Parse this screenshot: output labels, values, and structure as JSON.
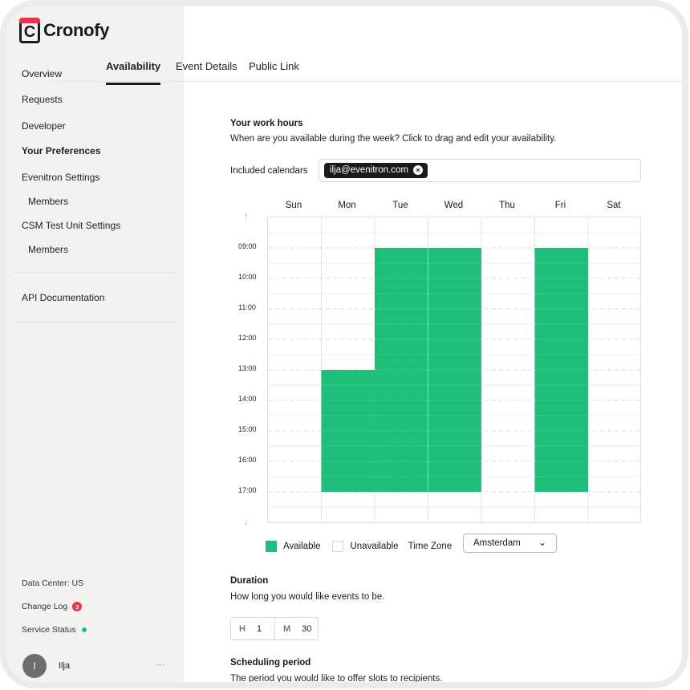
{
  "app": {
    "name": "Cronofy",
    "logo_letter": "C"
  },
  "sidebar": {
    "items": [
      {
        "label": "Overview"
      },
      {
        "label": "Requests"
      },
      {
        "label": "Developer"
      },
      {
        "label": "Your Preferences"
      },
      {
        "label": "Evenitron Settings"
      },
      {
        "label": "Members"
      },
      {
        "label": "CSM Test Unit Settings"
      },
      {
        "label": "Members"
      },
      {
        "label": "API Documentation"
      }
    ],
    "footer": {
      "data_center": "Data Center: US",
      "change_log": "Change Log",
      "change_log_count": "3",
      "service_status": "Service Status",
      "status_color": "#1fbf7a"
    },
    "user": {
      "initial": "I",
      "name": "Ilja",
      "menu_icon": "⋮"
    }
  },
  "tabs": [
    {
      "label": "Availability"
    },
    {
      "label": "Event Details"
    },
    {
      "label": "Public Link"
    }
  ],
  "work_hours": {
    "title": "Your work hours",
    "description": "When are you available during the week? Click to drag and edit your availability.",
    "included_label": "Included calendars",
    "calendar_chip": "ilja@evenitron.com",
    "chip_remove_icon": "×"
  },
  "calendar": {
    "days": [
      "Sun",
      "Mon",
      "Tue",
      "Wed",
      "Thu",
      "Fri",
      "Sat"
    ],
    "times": [
      "09:00",
      "10:00",
      "11:00",
      "12:00",
      "13:00",
      "14:00",
      "15:00",
      "16:00",
      "17:00"
    ],
    "up_arrow": "↑",
    "down_arrow": "↓",
    "available_color": "#1fbf7a",
    "availability": [
      {
        "day": "Mon",
        "start": "13:00",
        "end": "17:00"
      },
      {
        "day": "Tue",
        "start": "09:00",
        "end": "17:00"
      },
      {
        "day": "Wed",
        "start": "09:00",
        "end": "17:00"
      },
      {
        "day": "Fri",
        "start": "09:00",
        "end": "17:00"
      }
    ]
  },
  "legend": {
    "available": "Available",
    "unavailable": "Unavailable",
    "timezone_label": "Time Zone",
    "timezone_value": "Amsterdam",
    "chevron_icon": "⌄"
  },
  "duration": {
    "title": "Duration",
    "description": "How long you would like events to be.",
    "hours_unit": "H",
    "hours_value": "1",
    "minutes_unit": "M",
    "minutes_value": "30"
  },
  "scheduling": {
    "title": "Scheduling period",
    "description": "The period you would like to offer slots to recipients."
  }
}
